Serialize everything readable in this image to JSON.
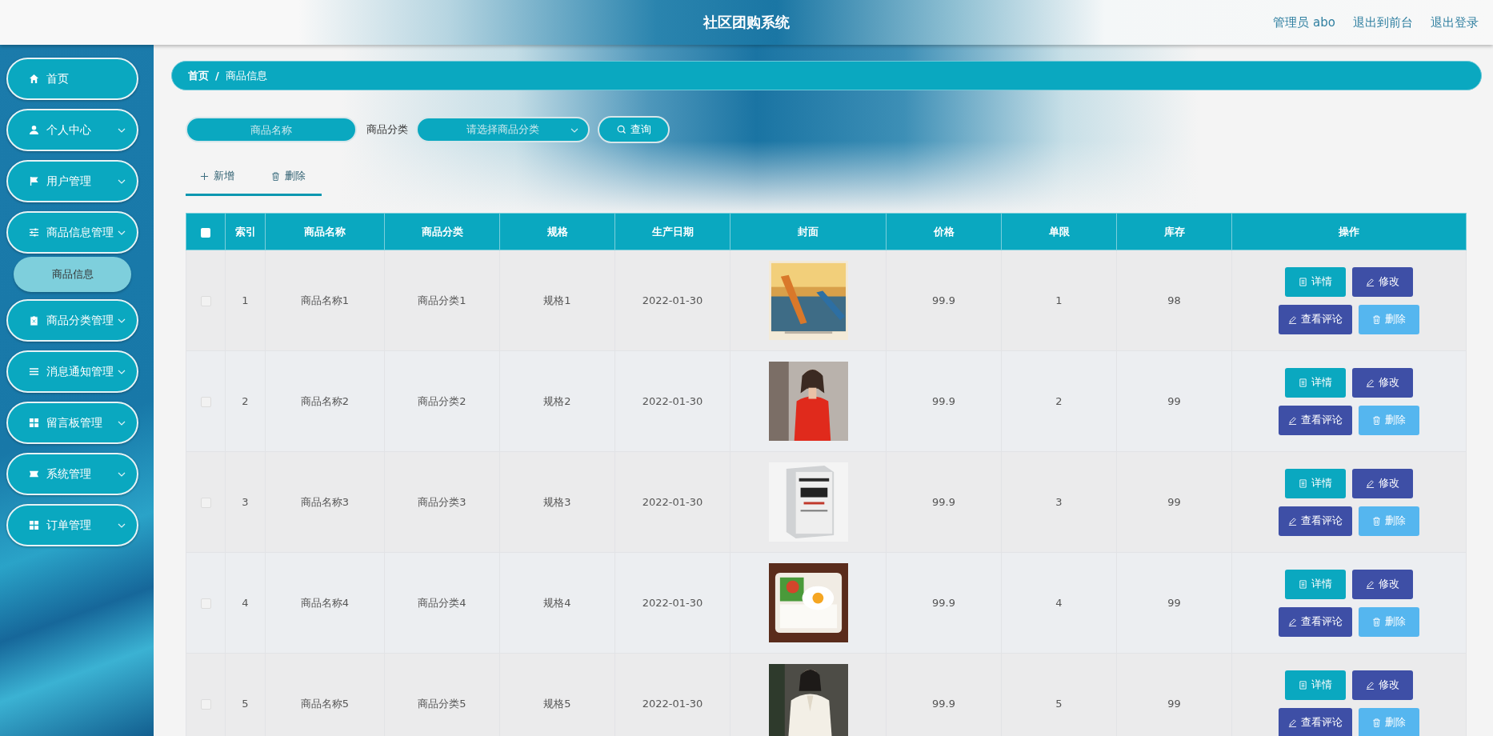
{
  "header": {
    "title": "社区团购系统",
    "links": [
      "管理员 abo",
      "退出到前台",
      "退出登录"
    ]
  },
  "sidebar": {
    "items": [
      {
        "label": "首页",
        "has_submenu": false
      },
      {
        "label": "个人中心",
        "has_submenu": true,
        "expanded": false
      },
      {
        "label": "用户管理",
        "has_submenu": true,
        "expanded": false
      },
      {
        "label": "商品信息管理",
        "has_submenu": true,
        "expanded": true,
        "children": [
          {
            "label": "商品信息",
            "selected": true
          }
        ]
      },
      {
        "label": "商品分类管理",
        "has_submenu": true,
        "expanded": false
      },
      {
        "label": "消息通知管理",
        "has_submenu": true,
        "expanded": false
      },
      {
        "label": "留言板管理",
        "has_submenu": true,
        "expanded": false
      },
      {
        "label": "系统管理",
        "has_submenu": true,
        "expanded": false
      },
      {
        "label": "订单管理",
        "has_submenu": true,
        "expanded": false
      }
    ]
  },
  "breadcrumb": {
    "items": [
      "首页",
      "商品信息"
    ],
    "separator": "/"
  },
  "search": {
    "name_field": {
      "placeholder": "商品名称"
    },
    "category_label": "商品分类",
    "category_select": {
      "placeholder": "请选择商品分类"
    },
    "button": "查询"
  },
  "toolbar": [
    {
      "label": "新增",
      "kind": "add"
    },
    {
      "label": "删除",
      "kind": "delete"
    }
  ],
  "table": {
    "select_all": {
      "checked": false
    },
    "columns": [
      "索引",
      "商品名称",
      "商品分类",
      "规格",
      "生产日期",
      "封面",
      "价格",
      "单限",
      "库存",
      "操作"
    ],
    "rows": [
      {
        "checked": false,
        "cells": [
          "1",
          "商品名称1",
          "商品分类1",
          "规格1",
          "2022-01-30"
        ],
        "cover": {
          "kind": "picture"
        },
        "tail": [
          "99.9",
          "1",
          "98"
        ],
        "actions": [
          {
            "label": "详情",
            "kind": "detail"
          },
          {
            "label": "修改",
            "kind": "edit"
          },
          {
            "label": "查看评论",
            "kind": "comments"
          },
          {
            "label": "删除",
            "kind": "delete"
          }
        ]
      },
      {
        "checked": false,
        "cells": [
          "2",
          "商品名称2",
          "商品分类2",
          "规格2",
          "2022-01-30"
        ],
        "cover": {
          "kind": "picture"
        },
        "tail": [
          "99.9",
          "2",
          "99"
        ],
        "actions": [
          {
            "label": "详情",
            "kind": "detail"
          },
          {
            "label": "修改",
            "kind": "edit"
          },
          {
            "label": "查看评论",
            "kind": "comments"
          },
          {
            "label": "删除",
            "kind": "delete"
          }
        ]
      },
      {
        "checked": false,
        "cells": [
          "3",
          "商品名称3",
          "商品分类3",
          "规格3",
          "2022-01-30"
        ],
        "cover": {
          "kind": "picture"
        },
        "tail": [
          "99.9",
          "3",
          "99"
        ],
        "actions": [
          {
            "label": "详情",
            "kind": "detail"
          },
          {
            "label": "修改",
            "kind": "edit"
          },
          {
            "label": "查看评论",
            "kind": "comments"
          },
          {
            "label": "删除",
            "kind": "delete"
          }
        ]
      },
      {
        "checked": false,
        "cells": [
          "4",
          "商品名称4",
          "商品分类4",
          "规格4",
          "2022-01-30"
        ],
        "cover": {
          "kind": "picture"
        },
        "tail": [
          "99.9",
          "4",
          "99"
        ],
        "actions": [
          {
            "label": "详情",
            "kind": "detail"
          },
          {
            "label": "修改",
            "kind": "edit"
          },
          {
            "label": "查看评论",
            "kind": "comments"
          },
          {
            "label": "删除",
            "kind": "delete"
          }
        ]
      },
      {
        "checked": false,
        "cells": [
          "5",
          "商品名称5",
          "商品分类5",
          "规格5",
          "2022-01-30"
        ],
        "cover": {
          "kind": "picture"
        },
        "tail": [
          "99.9",
          "5",
          "99"
        ],
        "actions": [
          {
            "label": "详情",
            "kind": "detail"
          },
          {
            "label": "修改",
            "kind": "edit"
          },
          {
            "label": "查看评论",
            "kind": "comments"
          },
          {
            "label": "删除",
            "kind": "delete"
          }
        ]
      }
    ]
  }
}
